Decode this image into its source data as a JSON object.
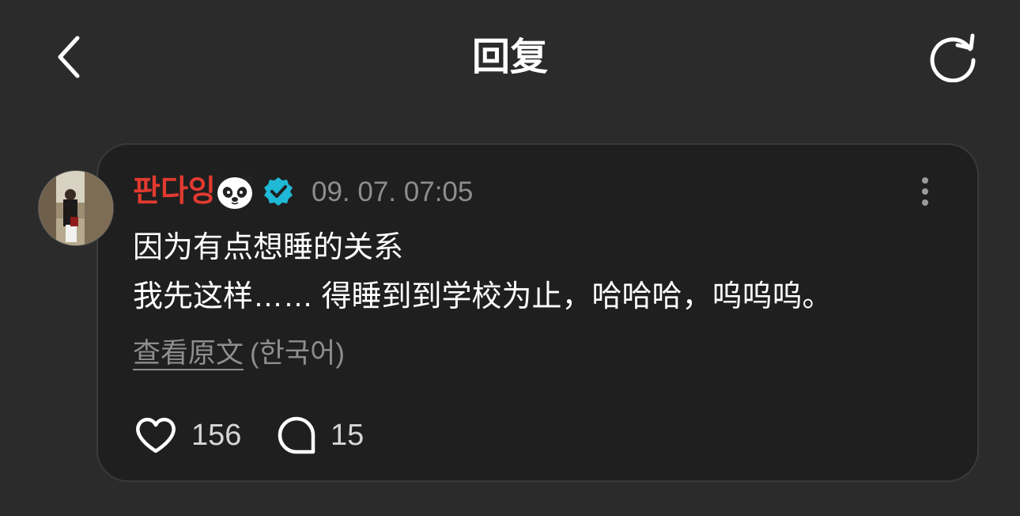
{
  "header": {
    "title": "回复",
    "back_icon": "chevron-left-icon",
    "refresh_icon": "refresh-icon"
  },
  "post": {
    "username": "판다잉",
    "username_color": "#e23a30",
    "username_emoji": "panda-icon",
    "verified_icon": "verified-badge-icon",
    "verified_color": "#1fb8d6",
    "timestamp": "09. 07. 07:05",
    "body_lines": [
      "因为有点想睡的关系",
      "我先这样…… 得睡到到学校为止，哈哈哈，呜呜呜。"
    ],
    "translate_link": "查看原文",
    "translate_lang": "(한국어)",
    "likes": "156",
    "replies": "15",
    "more_icon": "more-vertical-icon",
    "like_icon": "heart-icon",
    "reply_icon": "comment-bubble-icon"
  },
  "colors": {
    "background": "#2b2b2b",
    "card": "#1f1f1f",
    "muted_text": "#8e8e8e"
  }
}
